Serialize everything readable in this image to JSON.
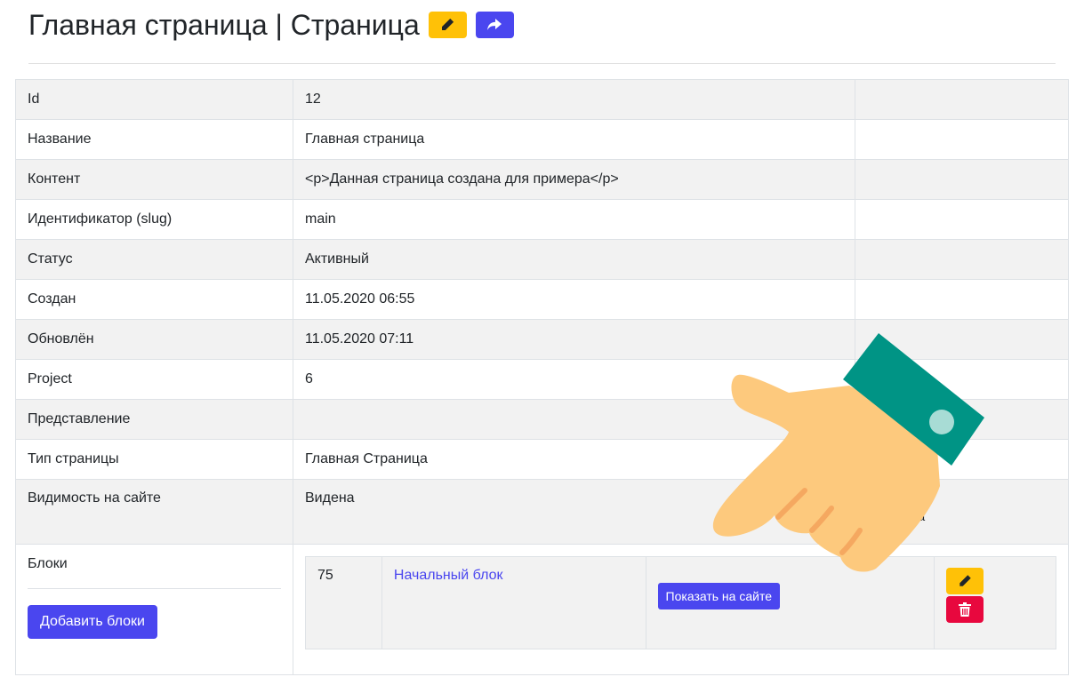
{
  "header": {
    "title": "Главная страница | Страница"
  },
  "colors": {
    "accent": "#4a46ef",
    "warning": "#ffc107",
    "danger": "#e8083e"
  },
  "icons": {
    "edit": "pencil-icon",
    "share": "share-arrow-icon",
    "delete": "trash-icon"
  },
  "rows": {
    "id": {
      "label": "Id",
      "value": "12"
    },
    "name": {
      "label": "Название",
      "value": "Главная страница"
    },
    "content": {
      "label": "Контент",
      "value": "<p>Данная страница создана для примера</p>"
    },
    "slug": {
      "label": "Идентификатор (slug)",
      "value": "main"
    },
    "status": {
      "label": "Статус",
      "value": "Активный"
    },
    "created": {
      "label": "Создан",
      "value": "11.05.2020 06:55"
    },
    "updated": {
      "label": "Обновлён",
      "value": "11.05.2020 07:11"
    },
    "project": {
      "label": "Project",
      "value": "6"
    },
    "view": {
      "label": "Представление",
      "value": ""
    },
    "page_type": {
      "label": "Тип страницы",
      "value": "Главная Страница"
    },
    "visibility": {
      "label": "Видимость на сайте",
      "value": "Видена",
      "action_partial": "ть с сайта"
    }
  },
  "blocks": {
    "label": "Блоки",
    "add_label": "Добавить блоки",
    "items": [
      {
        "id": "75",
        "name": "Начальный блок",
        "show_label": "Показать на сайте"
      }
    ]
  }
}
